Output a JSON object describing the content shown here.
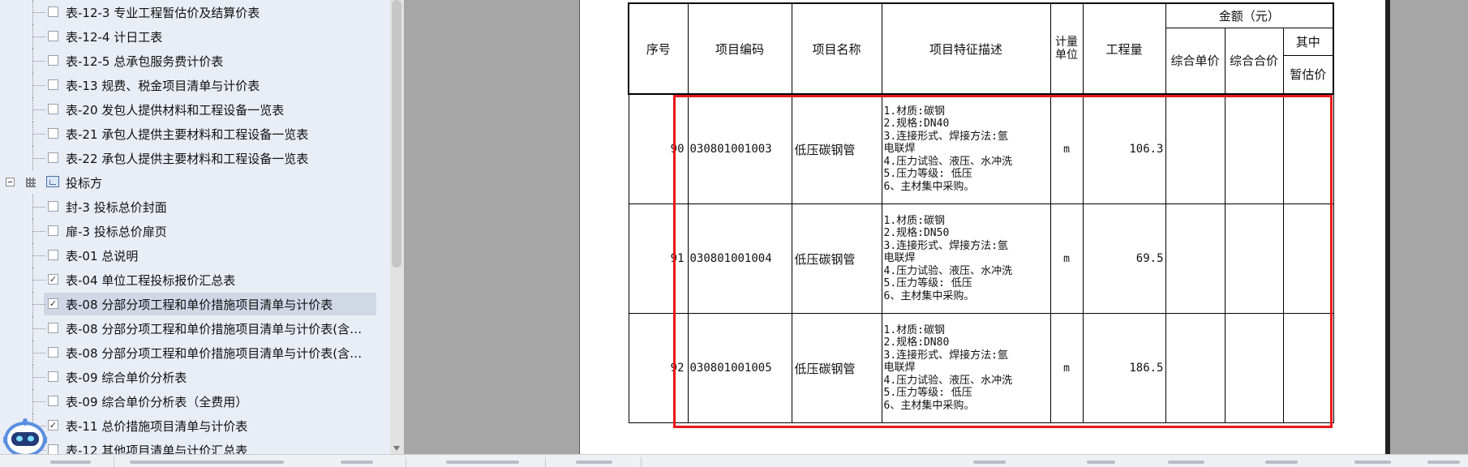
{
  "tree": {
    "items": [
      {
        "label": "表-12-3 专业工程暂估价及结算价表",
        "checked": false
      },
      {
        "label": "表-12-4 计日工表",
        "checked": false
      },
      {
        "label": "表-12-5 总承包服务费计价表",
        "checked": false
      },
      {
        "label": "表-13 规费、税金项目清单与计价表",
        "checked": false
      },
      {
        "label": "表-20 发包人提供材料和工程设备一览表",
        "checked": false
      },
      {
        "label": "表-21 承包人提供主要材料和工程设备一览表",
        "checked": false
      },
      {
        "label": "表-22 承包人提供主要材料和工程设备一览表",
        "checked": false
      },
      {
        "label": "投标方",
        "group": true
      },
      {
        "label": "封-3 投标总价封面",
        "checked": false
      },
      {
        "label": "扉-3 投标总价扉页",
        "checked": false
      },
      {
        "label": "表-01 总说明",
        "checked": false
      },
      {
        "label": "表-04 单位工程投标报价汇总表",
        "checked": true
      },
      {
        "label": "表-08 分部分项工程和单价措施项目清单与计价表",
        "checked": true,
        "selected": true
      },
      {
        "label": "表-08 分部分项工程和单价措施项目清单与计价表(含…",
        "checked": false
      },
      {
        "label": "表-08 分部分项工程和单价措施项目清单与计价表(含…",
        "checked": false
      },
      {
        "label": "表-09 综合单价分析表",
        "checked": false
      },
      {
        "label": "表-09 综合单价分析表（全费用）",
        "checked": false
      },
      {
        "label": "表-11 总价措施项目清单与计价表",
        "checked": true
      },
      {
        "label": "表-12 其他项目清单与计价汇总表",
        "checked": false
      }
    ]
  },
  "table": {
    "headers": {
      "index": "序号",
      "code": "项目编码",
      "name": "项目名称",
      "desc": "项目特征描述",
      "unit_l1": "计量",
      "unit_l2": "单位",
      "qty": "工程量",
      "amount": "金额（元）",
      "unit_price": "综合单价",
      "total": "综合合价",
      "of_which": "其中",
      "provisional": "暂估价"
    },
    "rows": [
      {
        "index": "90",
        "code": "030801001003",
        "name": "低压碳钢管",
        "desc": [
          "1.材质:碳钢",
          "2.规格:DN40",
          "3.连接形式、焊接方法:氩",
          "电联焊",
          "4.压力试验、液压、水冲洗",
          "5.压力等级: 低压",
          "6、主材集中采购。"
        ],
        "unit": "m",
        "qty": "106.3"
      },
      {
        "index": "91",
        "code": "030801001004",
        "name": "低压碳钢管",
        "desc": [
          "1.材质:碳钢",
          "2.规格:DN50",
          "3.连接形式、焊接方法:氩",
          "电联焊",
          "4.压力试验、液压、水冲洗",
          "5.压力等级: 低压",
          "6、主材集中采购。"
        ],
        "unit": "m",
        "qty": "69.5"
      },
      {
        "index": "92",
        "code": "030801001005",
        "name": "低压碳钢管",
        "desc": [
          "1.材质:碳钢",
          "2.规格:DN80",
          "3.连接形式、焊接方法:氩",
          "电联焊",
          "4.压力试验、液压、水冲洗",
          "5.压力等级: 低压",
          "6、主材集中采购。"
        ],
        "unit": "m",
        "qty": "186.5"
      }
    ]
  },
  "colors": {
    "highlight": "#e81818",
    "panel": "#e9edf5",
    "preview_bg": "#a6a6a6"
  },
  "icons": [
    "expander-minus-icon",
    "grid-icon",
    "folder-icon",
    "checkbox-icon",
    "robot-assistant-icon"
  ]
}
